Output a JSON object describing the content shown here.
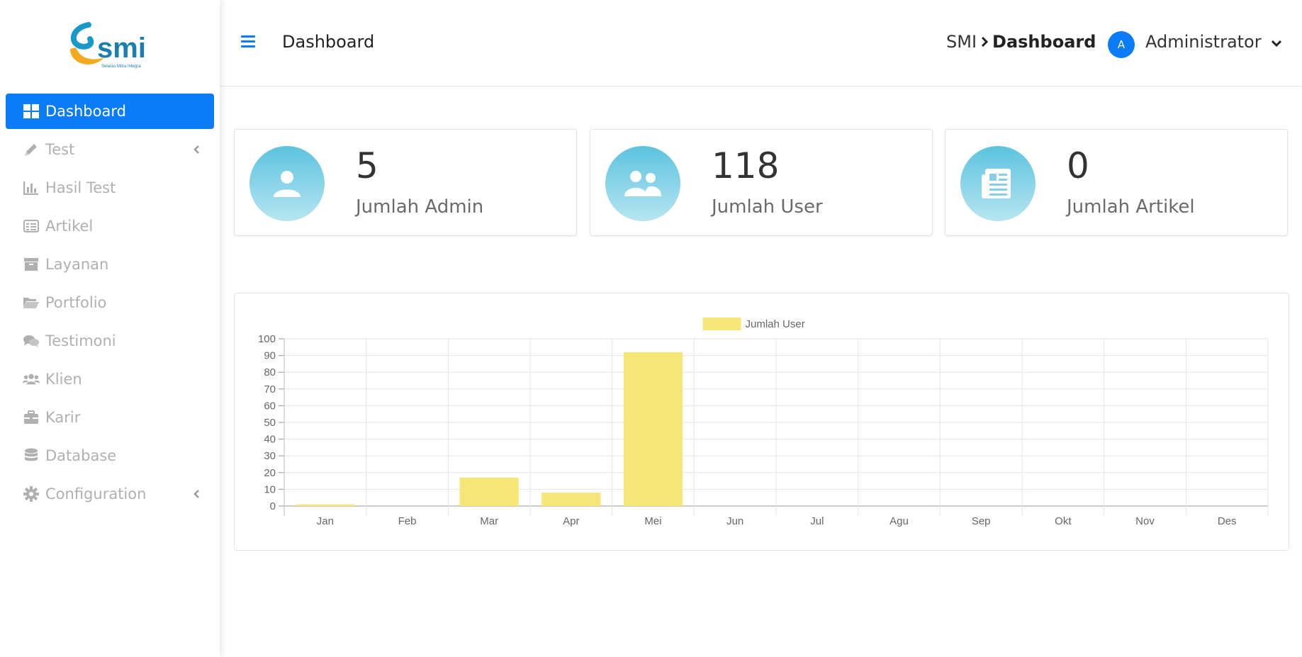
{
  "logo": {
    "text": "smi",
    "tagline": "Selaras Mitra Integra"
  },
  "sidebar": {
    "items": [
      {
        "label": "Dashboard",
        "icon": "grid-icon",
        "active": true
      },
      {
        "label": "Test",
        "icon": "pencil-icon",
        "has_submenu": true
      },
      {
        "label": "Hasil Test",
        "icon": "bar-chart-icon"
      },
      {
        "label": "Artikel",
        "icon": "list-alt-icon"
      },
      {
        "label": "Layanan",
        "icon": "archive-icon"
      },
      {
        "label": "Portfolio",
        "icon": "folder-open-icon"
      },
      {
        "label": "Testimoni",
        "icon": "comments-icon"
      },
      {
        "label": "Klien",
        "icon": "users-icon"
      },
      {
        "label": "Karir",
        "icon": "briefcase-icon"
      },
      {
        "label": "Database",
        "icon": "database-icon"
      },
      {
        "label": "Configuration",
        "icon": "gear-icon",
        "has_submenu": true
      }
    ]
  },
  "header": {
    "title": "Dashboard",
    "breadcrumb": {
      "root": "SMI",
      "separator": ">",
      "current": "Dashboard"
    },
    "user": {
      "initial": "A",
      "name": "Administrator"
    }
  },
  "stats": [
    {
      "value": "5",
      "label": "Jumlah Admin",
      "icon": "user-icon"
    },
    {
      "value": "118",
      "label": "Jumlah User",
      "icon": "users-icon"
    },
    {
      "value": "0",
      "label": "Jumlah Artikel",
      "icon": "newspaper-icon"
    }
  ],
  "colors": {
    "accent": "#0b7cf7",
    "bar_fill": "#f6e677",
    "stat_circle_top": "#5cc3df",
    "stat_circle_bottom": "#b7e5f1"
  },
  "chart_data": {
    "type": "bar",
    "categories": [
      "Jan",
      "Feb",
      "Mar",
      "Apr",
      "Mei",
      "Jun",
      "Jul",
      "Agu",
      "Sep",
      "Okt",
      "Nov",
      "Des"
    ],
    "series": [
      {
        "name": "Jumlah User",
        "values": [
          1,
          0,
          17,
          8,
          92,
          0,
          0,
          0,
          0,
          0,
          0,
          0
        ]
      }
    ],
    "ylim": [
      0,
      100
    ],
    "y_ticks": [
      0,
      10,
      20,
      30,
      40,
      50,
      60,
      70,
      80,
      90,
      100
    ],
    "grid": true,
    "legend": "top-center"
  }
}
